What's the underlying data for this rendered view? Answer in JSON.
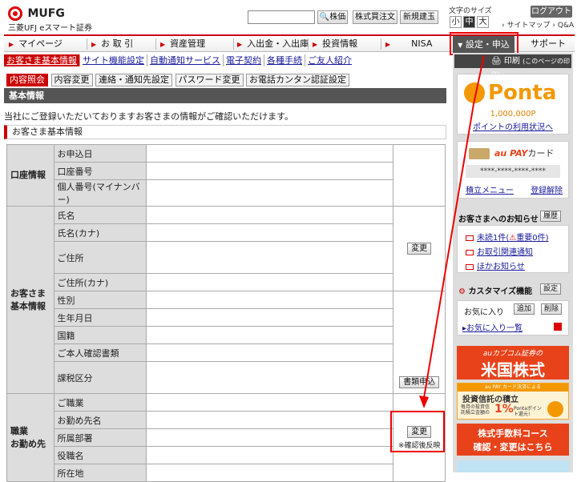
{
  "header": {
    "brand": "MUFG",
    "brand_sub": "三菱UFJ eスマート証券",
    "search_placeholder": "",
    "btn_stock_price": "株価",
    "btn_stock_order": "株式買注文",
    "btn_new_buy": "新規建玉",
    "fontsize_label": "文字のサイズ",
    "fontsize_small": "小",
    "fontsize_medium": "中",
    "fontsize_large": "大",
    "logout": "ログアウト",
    "sitemap": "サイトマップ",
    "qa": "Q&A"
  },
  "nav": {
    "items": [
      "マイページ",
      "お 取 引",
      "資産管理",
      "入出金・入出庫",
      "投資情報",
      "NISA",
      "設定・申込",
      "サポート"
    ]
  },
  "subnav": {
    "items": [
      "お客さま基本情報",
      "サイト機能設定",
      "自動通知サービス",
      "電子契約",
      "各種手続",
      "ご友人紹介"
    ]
  },
  "tabs": [
    "内容照会",
    "内容変更",
    "連絡・通知先設定",
    "パスワード変更",
    "お電話カンタン認証設定"
  ],
  "main": {
    "section_title": "基本情報",
    "intro": "当社にご登録いただいておりますお客さまの情報がご確認いただけます。",
    "subhead": "お客さま基本情報",
    "groups": [
      {
        "category": "口座情報",
        "labels": [
          "お申込日",
          "口座番号",
          "個人番号(マイナンバー)"
        ]
      },
      {
        "category": "お客さま基本情報",
        "labels": [
          "氏名",
          "氏名(カナ)",
          "ご住所",
          "ご住所(カナ)",
          "性別",
          "生年月日",
          "国籍",
          "ご本人確認書類",
          "課税区分"
        ]
      },
      {
        "category": "職業お勤め先",
        "labels": [
          "ご職業",
          "お勤め先名",
          "所属部署",
          "役職名",
          "所在地"
        ]
      }
    ],
    "btn_change": "変更",
    "btn_documents": "書類申込",
    "btn_change2": "変更",
    "note_reflect": "※確認後反映"
  },
  "sidebar": {
    "print": "印刷",
    "print_note": "(このページの印刷)",
    "ponta_logo": "Ponta",
    "ponta_points": "1,000,000P",
    "ponta_link": "ポイントの利用状況へ",
    "au_brand": "au PAY",
    "au_card": "カード",
    "au_number": "****-****-****-****",
    "au_link1": "積立メニュー",
    "au_link2": "登録解除",
    "notice_head": "お客さまへのお知らせ",
    "notice_history": "履歴",
    "notice_unread": "未読1件(",
    "notice_important": "重要0件",
    "notice_close": ")",
    "notice_2": "お取引関連通知",
    "notice_3": "ほかお知らせ",
    "custom_head": "カスタマイズ機能",
    "custom_btn": "設定",
    "fav_label": "お気に入り",
    "fav_add": "追加",
    "fav_delete": "削除",
    "fav_list": "お気に入り一覧",
    "banner_us_small": "auカブコム証券の",
    "banner_us": "米国株式",
    "banner_fund_top": "au PAY カード決済による",
    "banner_fund": "投資信託の積立",
    "banner_fund_note1": "毎月の投資信託積立金額の",
    "banner_fund_pct": "1%",
    "banner_fund_note2": "Pontaポイント還元!",
    "banner_fee_1": "株式手数料コース",
    "banner_fee_2": "確認・変更はこちら"
  },
  "colors": {
    "accent": "#cc0000",
    "nav_dark": "#555555",
    "highlight": "#e00000",
    "ponta": "#f39800"
  }
}
